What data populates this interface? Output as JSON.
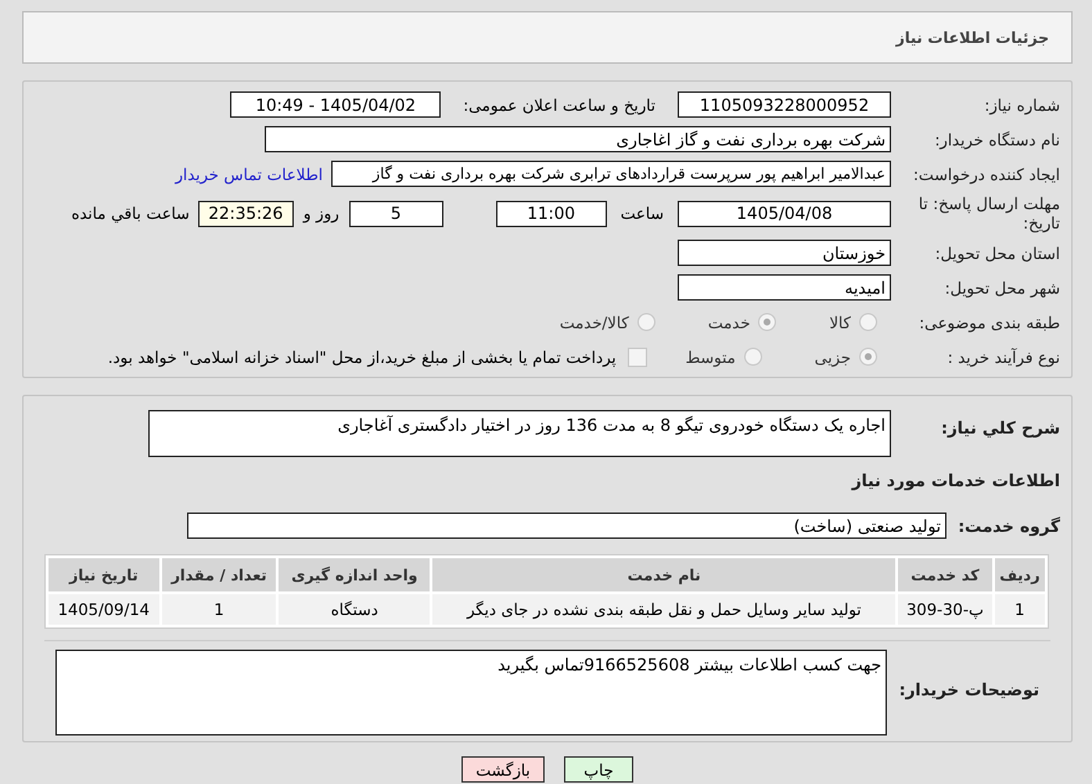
{
  "header": {
    "title": "جزئیات اطلاعات نیاز"
  },
  "details": {
    "need_number": {
      "label": "شماره نیاز:",
      "value": "1105093228000952"
    },
    "announce": {
      "label": "تاریخ و ساعت اعلان عمومی:",
      "value": "1405/04/02 - 10:49"
    },
    "buyer": {
      "label": "نام دستگاه خریدار:",
      "value": "شرکت بهره برداری نفت و گاز اغاجاری"
    },
    "creator": {
      "label": "ایجاد کننده درخواست:",
      "value": "عبدالامیر ابراهیم پور سرپرست قراردادهای ترابری شرکت بهره برداری نفت و گاز",
      "link": "اطلاعات تماس خریدار"
    },
    "deadline": {
      "label": "مهلت ارسال پاسخ: تا تاریخ:",
      "date": "1405/04/08",
      "time_label": "ساعت",
      "time": "11:00",
      "days": "5",
      "days_label": "روز و",
      "remaining": "22:35:26",
      "remaining_label": "ساعت باقي مانده"
    },
    "province": {
      "label": "استان محل تحویل:",
      "value": "خوزستان"
    },
    "city": {
      "label": "شهر محل تحویل:",
      "value": "امیدیه"
    },
    "category": {
      "label": "طبقه بندی موضوعی:",
      "options": [
        {
          "label": "کالا",
          "selected": false
        },
        {
          "label": "خدمت",
          "selected": true
        },
        {
          "label": "کالا/خدمت",
          "selected": false
        }
      ]
    },
    "process": {
      "label": "نوع فرآیند خرید :",
      "options": [
        {
          "label": "جزیی",
          "selected": true
        },
        {
          "label": "متوسط",
          "selected": false
        }
      ],
      "treasury": {
        "checked": false,
        "label": "پرداخت تمام یا بخشی از مبلغ خرید،از محل \"اسناد خزانه اسلامی\" خواهد بود."
      }
    }
  },
  "summary": {
    "label": "شرح کلي نياز:",
    "value": "اجاره یک دستگاه خودروی تیگو 8 به مدت 136 روز در اختیار دادگستری آغاجاری"
  },
  "services": {
    "heading": "اطلاعات خدمات مورد نیاز",
    "group_label": "گروه خدمت:",
    "group": "تولید صنعتی (ساخت)",
    "columns": [
      "ردیف",
      "کد خدمت",
      "نام خدمت",
      "واحد اندازه گیری",
      "تعداد / مقدار",
      "تاریخ نیاز"
    ],
    "rows": [
      [
        "1",
        "پ-30-309",
        "تولید سایر وسایل حمل و نقل طبقه بندی نشده در جای دیگر",
        "دستگاه",
        "1",
        "1405/09/14"
      ]
    ]
  },
  "notes": {
    "label": "توضیحات خریدار:",
    "value": "جهت کسب اطلاعات بیشتر 9166525608تماس بگیرید"
  },
  "buttons": [
    {
      "label": "چاپ",
      "kind": "print"
    },
    {
      "label": "بازگشت",
      "kind": "back"
    }
  ]
}
